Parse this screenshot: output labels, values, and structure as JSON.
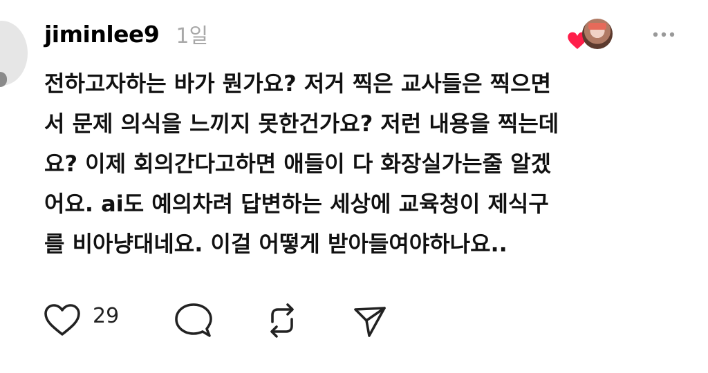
{
  "post": {
    "username": "jiminlee9",
    "time": "1일",
    "body_lines": [
      "전하고자하는 바가 뭔가요? 저거 찍은 교사들은 찍으면",
      "서 문제 의식을 느끼지 못한건가요? 저런 내용을 찍는데",
      "요? 이제 회의간다고하면 애들이 다 화장실가는줄 알겠",
      "어요. ai도 예의차려 답변하는 세상에 교육청이 제식구",
      "를 비아냥대네요. 이걸 어떻게 받아들여야하나요.."
    ]
  },
  "actions": {
    "like_count": "29"
  },
  "colors": {
    "heart_red": "#ff1e4a",
    "muted_gray": "#a8a8a8"
  }
}
